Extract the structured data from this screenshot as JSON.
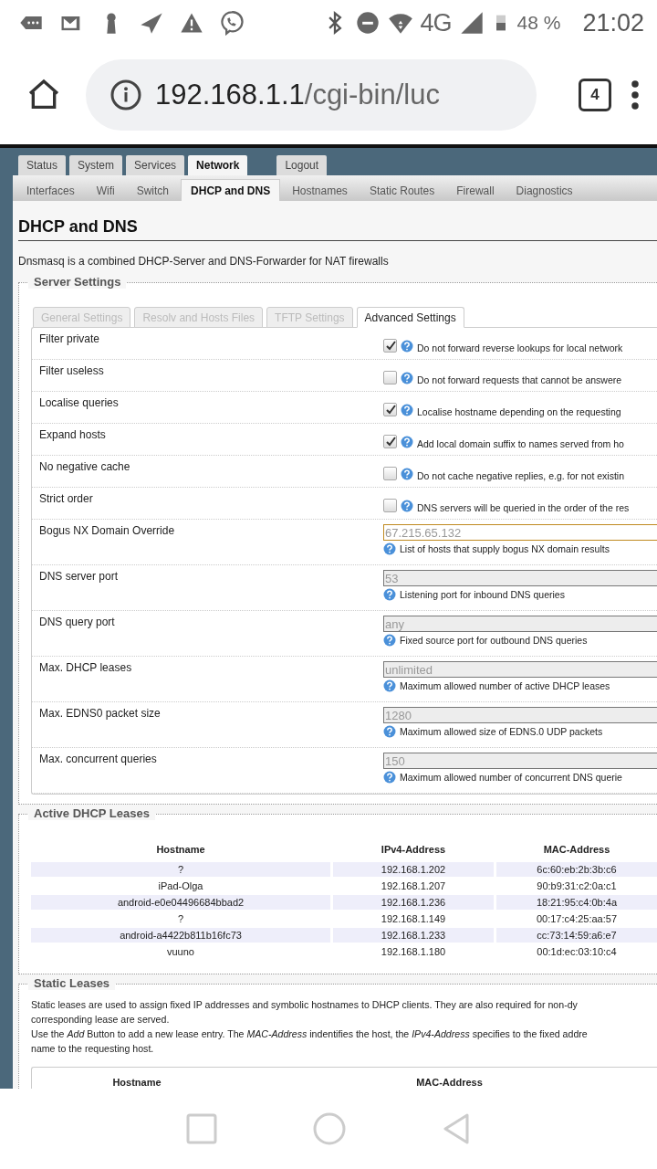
{
  "status_bar": {
    "network": "4G",
    "battery": "48 %",
    "time": "21:02"
  },
  "browser": {
    "url_host": "192.168.1.1",
    "url_path": "/cgi-bin/luc",
    "tab_count": "4"
  },
  "main_tabs": [
    {
      "label": "Status",
      "selected": false
    },
    {
      "label": "System",
      "selected": false
    },
    {
      "label": "Services",
      "selected": false
    },
    {
      "label": "Network",
      "selected": true
    }
  ],
  "logout_tab": {
    "label": "Logout"
  },
  "sub_tabs": [
    {
      "label": "Interfaces",
      "selected": false
    },
    {
      "label": "Wifi",
      "selected": false
    },
    {
      "label": "Switch",
      "selected": false
    },
    {
      "label": "DHCP and DNS",
      "selected": true
    },
    {
      "label": "Hostnames",
      "selected": false
    },
    {
      "label": "Static Routes",
      "selected": false
    },
    {
      "label": "Firewall",
      "selected": false
    },
    {
      "label": "Diagnostics",
      "selected": false
    }
  ],
  "page": {
    "title": "DHCP and DNS",
    "description": "Dnsmasq is a combined DHCP-Server and DNS-Forwarder for NAT firewalls"
  },
  "server_settings": {
    "legend": "Server Settings",
    "tabs": [
      {
        "label": "General Settings",
        "selected": false
      },
      {
        "label": "Resolv and Hosts Files",
        "selected": false
      },
      {
        "label": "TFTP Settings",
        "selected": false
      },
      {
        "label": "Advanced Settings",
        "selected": true
      }
    ],
    "rows": [
      {
        "kind": "checkbox",
        "label": "Filter private",
        "checked": true,
        "hint": "Do not forward reverse lookups for local network"
      },
      {
        "kind": "checkbox",
        "label": "Filter useless",
        "checked": false,
        "hint": "Do not forward requests that cannot be answere"
      },
      {
        "kind": "checkbox",
        "label": "Localise queries",
        "checked": true,
        "hint": "Localise hostname depending on the requesting"
      },
      {
        "kind": "checkbox",
        "label": "Expand hosts",
        "checked": true,
        "hint": "Add local domain suffix to names served from ho"
      },
      {
        "kind": "checkbox",
        "label": "No negative cache",
        "checked": false,
        "hint": "Do not cache negative replies, e.g. for not existin"
      },
      {
        "kind": "checkbox",
        "label": "Strict order",
        "checked": false,
        "hint": "DNS servers will be queried in the order of the res"
      },
      {
        "kind": "input",
        "label": "Bogus NX Domain Override",
        "placeholder": "67.215.65.132",
        "focused": true,
        "hint": "List of hosts that supply bogus NX domain results"
      },
      {
        "kind": "input",
        "label": "DNS server port",
        "placeholder": "53",
        "focused": false,
        "hint": "Listening port for inbound DNS queries"
      },
      {
        "kind": "input",
        "label": "DNS query port",
        "placeholder": "any",
        "focused": false,
        "hint": "Fixed source port for outbound DNS queries"
      },
      {
        "kind": "input",
        "label": "Max. DHCP leases",
        "placeholder": "unlimited",
        "focused": false,
        "hint": "Maximum allowed number of active DHCP leases"
      },
      {
        "kind": "input",
        "label": "Max. EDNS0 packet size",
        "placeholder": "1280",
        "focused": false,
        "hint": "Maximum allowed size of EDNS.0 UDP packets"
      },
      {
        "kind": "input",
        "label": "Max. concurrent queries",
        "placeholder": "150",
        "focused": false,
        "hint": "Maximum allowed number of concurrent DNS querie"
      }
    ]
  },
  "active_leases": {
    "legend": "Active DHCP Leases",
    "columns": [
      "Hostname",
      "IPv4-Address",
      "MAC-Address"
    ],
    "rows": [
      [
        "?",
        "192.168.1.202",
        "6c:60:eb:2b:3b:c6"
      ],
      [
        "iPad-Olga",
        "192.168.1.207",
        "90:b9:31:c2:0a:c1"
      ],
      [
        "android-e0e04496684bbad2",
        "192.168.1.236",
        "18:21:95:c4:0b:4a"
      ],
      [
        "?",
        "192.168.1.149",
        "00:17:c4:25:aa:57"
      ],
      [
        "android-a4422b811b16fc73",
        "192.168.1.233",
        "cc:73:14:59:a6:e7"
      ],
      [
        "vuuno",
        "192.168.1.180",
        "00:1d:ec:03:10:c4"
      ]
    ]
  },
  "static_leases": {
    "legend": "Static Leases",
    "lines": [
      "Static leases are used to assign fixed IP addresses and symbolic hostnames to DHCP clients. They are also required for non-dy",
      "corresponding lease are served.",
      "Use the *Add* Button to add a new lease entry. The *MAC-Address* indentifies the host, the *IPv4-Address* specifies to the fixed addre",
      "name to the requesting host."
    ],
    "columns": [
      "Hostname",
      "MAC-Address"
    ]
  }
}
